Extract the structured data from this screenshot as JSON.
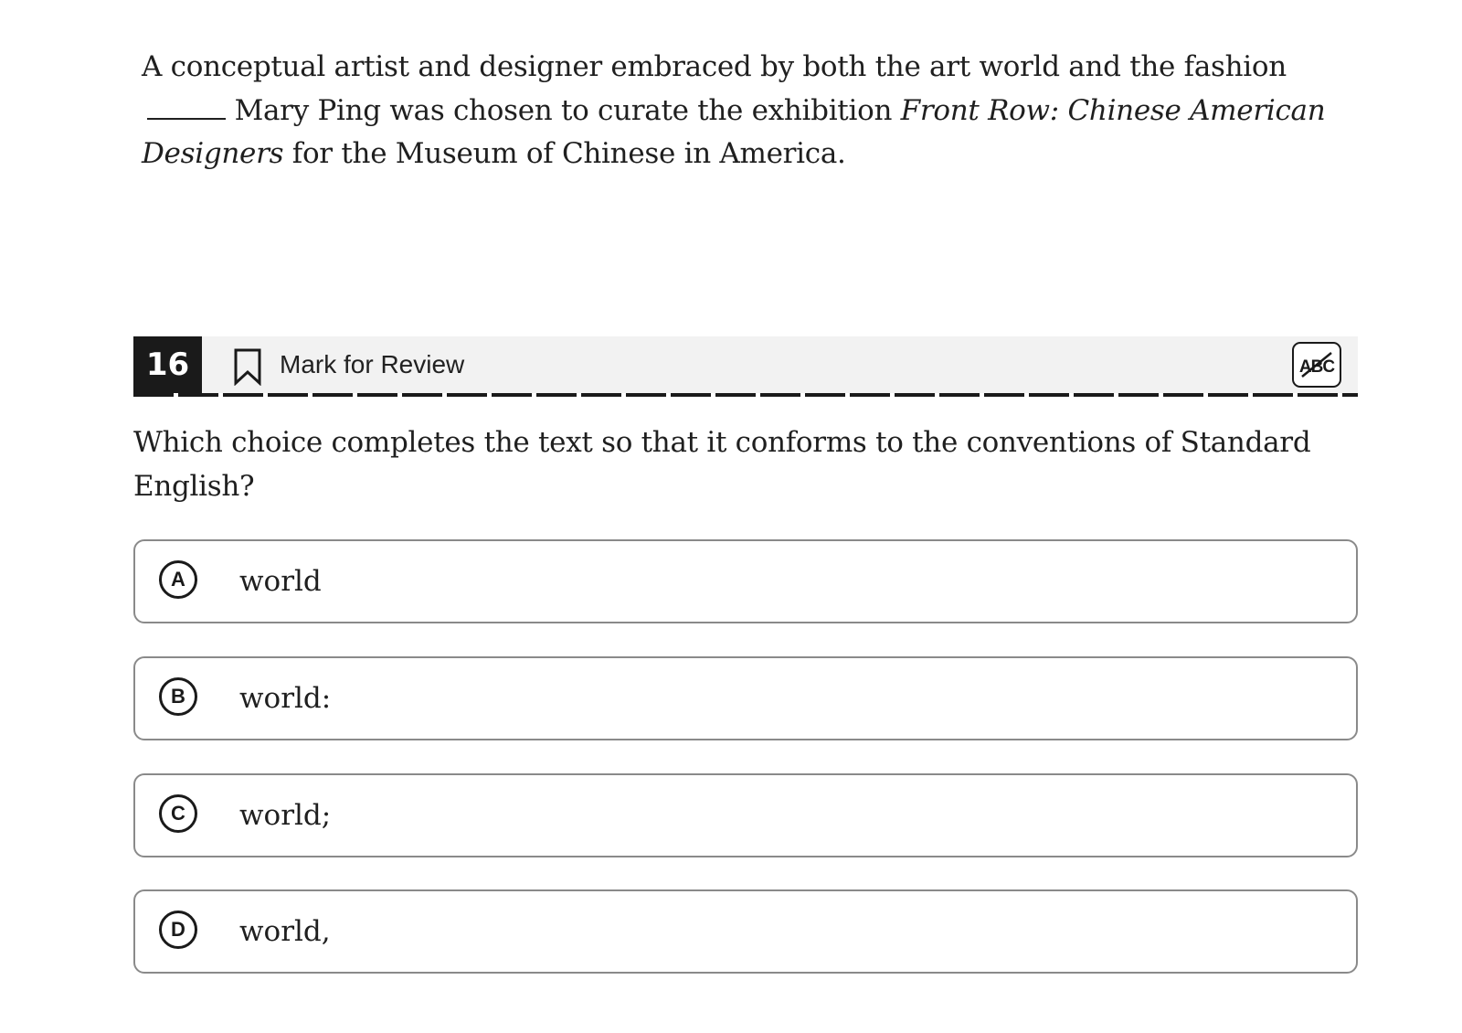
{
  "passage": {
    "part1": "A conceptual artist and designer embraced by both the art world and the fashion",
    "part2": "Mary Ping was chosen to curate the exhibition ",
    "italic_title": "Front Row: Chinese American Designers",
    "part3": " for the Museum of Chinese in America."
  },
  "question_header": {
    "number": "16",
    "mark_label": "Mark for Review",
    "bookmark_icon": "bookmark-icon",
    "abc_icon": "abc-strikethrough-icon"
  },
  "question": {
    "text": "Which choice completes the text so that it conforms to the conventions of Standard English?"
  },
  "choices": [
    {
      "letter": "A",
      "text": "world"
    },
    {
      "letter": "B",
      "text": "world:"
    },
    {
      "letter": "C",
      "text": "world;"
    },
    {
      "letter": "D",
      "text": "world,"
    }
  ],
  "colors": {
    "number_badge_bg": "#1a1a1a",
    "header_bar_bg": "#f2f2f2",
    "choice_border": "#8a8a8a"
  }
}
